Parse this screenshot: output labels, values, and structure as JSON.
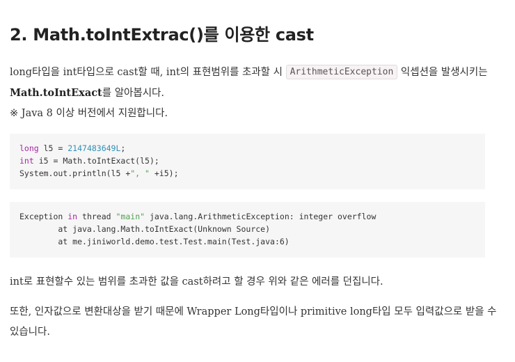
{
  "title": "2. Math.toIntExtrac()를 이용한 cast",
  "intro": {
    "part1": "long타입을 int타입으로 cast할 때, int의 표현범위를 초과할 시 ",
    "inline_code": "ArithmeticException",
    "part2": " 익셉션을 발생시키는 ",
    "method": "Math.toIntExact",
    "part3": "를 알아봅시다.",
    "note": "※ Java 8 이상 버전에서 지원합니다."
  },
  "code_block_1": {
    "lines": [
      "long l5 = 2147483649L;",
      "int i5 = Math.toIntExact(l5);",
      "System.out.println(l5 +\", \" +i5);"
    ]
  },
  "code_block_2": {
    "lines": [
      "Exception in thread \"main\" java.lang.ArithmeticException: integer overflow",
      "        at java.lang.Math.toIntExact(Unknown Source)",
      "        at me.jiniworld.demo.test.Test.main(Test.java:6)"
    ]
  },
  "para_error": "int로 표현할수 있는 범위를 초과한 값을 cast하려고 할 경우 위와 같은 에러를 던집니다.",
  "para_param": "또한, 인자값으로 변환대상을 받기 때문에 Wrapper Long타입이나 primitive long타입 모두 입력값으로 받을 수 있습니다."
}
